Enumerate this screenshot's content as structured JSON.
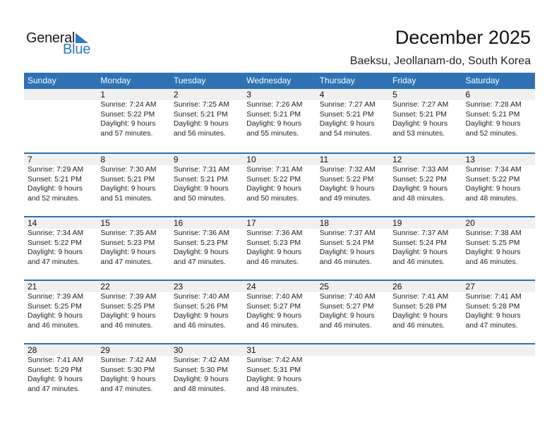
{
  "logo": {
    "word1": "General",
    "word2": "Blue",
    "icon": "triangle-flag-icon",
    "brand_color": "#2e78c0"
  },
  "header": {
    "title": "December 2025",
    "location": "Baeksu, Jeollanam-do, South Korea"
  },
  "colors": {
    "header_bg": "#2e72b4",
    "date_band_bg": "#f0f0f0",
    "row_border": "#2e72b4"
  },
  "weekdays": [
    "Sunday",
    "Monday",
    "Tuesday",
    "Wednesday",
    "Thursday",
    "Friday",
    "Saturday"
  ],
  "weeks": [
    [
      null,
      {
        "day": "1",
        "sunrise": "Sunrise: 7:24 AM",
        "sunset": "Sunset: 5:22 PM",
        "daylight1": "Daylight: 9 hours",
        "daylight2": "and 57 minutes."
      },
      {
        "day": "2",
        "sunrise": "Sunrise: 7:25 AM",
        "sunset": "Sunset: 5:21 PM",
        "daylight1": "Daylight: 9 hours",
        "daylight2": "and 56 minutes."
      },
      {
        "day": "3",
        "sunrise": "Sunrise: 7:26 AM",
        "sunset": "Sunset: 5:21 PM",
        "daylight1": "Daylight: 9 hours",
        "daylight2": "and 55 minutes."
      },
      {
        "day": "4",
        "sunrise": "Sunrise: 7:27 AM",
        "sunset": "Sunset: 5:21 PM",
        "daylight1": "Daylight: 9 hours",
        "daylight2": "and 54 minutes."
      },
      {
        "day": "5",
        "sunrise": "Sunrise: 7:27 AM",
        "sunset": "Sunset: 5:21 PM",
        "daylight1": "Daylight: 9 hours",
        "daylight2": "and 53 minutes."
      },
      {
        "day": "6",
        "sunrise": "Sunrise: 7:28 AM",
        "sunset": "Sunset: 5:21 PM",
        "daylight1": "Daylight: 9 hours",
        "daylight2": "and 52 minutes."
      }
    ],
    [
      {
        "day": "7",
        "sunrise": "Sunrise: 7:29 AM",
        "sunset": "Sunset: 5:21 PM",
        "daylight1": "Daylight: 9 hours",
        "daylight2": "and 52 minutes."
      },
      {
        "day": "8",
        "sunrise": "Sunrise: 7:30 AM",
        "sunset": "Sunset: 5:21 PM",
        "daylight1": "Daylight: 9 hours",
        "daylight2": "and 51 minutes."
      },
      {
        "day": "9",
        "sunrise": "Sunrise: 7:31 AM",
        "sunset": "Sunset: 5:21 PM",
        "daylight1": "Daylight: 9 hours",
        "daylight2": "and 50 minutes."
      },
      {
        "day": "10",
        "sunrise": "Sunrise: 7:31 AM",
        "sunset": "Sunset: 5:22 PM",
        "daylight1": "Daylight: 9 hours",
        "daylight2": "and 50 minutes."
      },
      {
        "day": "11",
        "sunrise": "Sunrise: 7:32 AM",
        "sunset": "Sunset: 5:22 PM",
        "daylight1": "Daylight: 9 hours",
        "daylight2": "and 49 minutes."
      },
      {
        "day": "12",
        "sunrise": "Sunrise: 7:33 AM",
        "sunset": "Sunset: 5:22 PM",
        "daylight1": "Daylight: 9 hours",
        "daylight2": "and 48 minutes."
      },
      {
        "day": "13",
        "sunrise": "Sunrise: 7:34 AM",
        "sunset": "Sunset: 5:22 PM",
        "daylight1": "Daylight: 9 hours",
        "daylight2": "and 48 minutes."
      }
    ],
    [
      {
        "day": "14",
        "sunrise": "Sunrise: 7:34 AM",
        "sunset": "Sunset: 5:22 PM",
        "daylight1": "Daylight: 9 hours",
        "daylight2": "and 47 minutes."
      },
      {
        "day": "15",
        "sunrise": "Sunrise: 7:35 AM",
        "sunset": "Sunset: 5:23 PM",
        "daylight1": "Daylight: 9 hours",
        "daylight2": "and 47 minutes."
      },
      {
        "day": "16",
        "sunrise": "Sunrise: 7:36 AM",
        "sunset": "Sunset: 5:23 PM",
        "daylight1": "Daylight: 9 hours",
        "daylight2": "and 47 minutes."
      },
      {
        "day": "17",
        "sunrise": "Sunrise: 7:36 AM",
        "sunset": "Sunset: 5:23 PM",
        "daylight1": "Daylight: 9 hours",
        "daylight2": "and 46 minutes."
      },
      {
        "day": "18",
        "sunrise": "Sunrise: 7:37 AM",
        "sunset": "Sunset: 5:24 PM",
        "daylight1": "Daylight: 9 hours",
        "daylight2": "and 46 minutes."
      },
      {
        "day": "19",
        "sunrise": "Sunrise: 7:37 AM",
        "sunset": "Sunset: 5:24 PM",
        "daylight1": "Daylight: 9 hours",
        "daylight2": "and 46 minutes."
      },
      {
        "day": "20",
        "sunrise": "Sunrise: 7:38 AM",
        "sunset": "Sunset: 5:25 PM",
        "daylight1": "Daylight: 9 hours",
        "daylight2": "and 46 minutes."
      }
    ],
    [
      {
        "day": "21",
        "sunrise": "Sunrise: 7:39 AM",
        "sunset": "Sunset: 5:25 PM",
        "daylight1": "Daylight: 9 hours",
        "daylight2": "and 46 minutes."
      },
      {
        "day": "22",
        "sunrise": "Sunrise: 7:39 AM",
        "sunset": "Sunset: 5:25 PM",
        "daylight1": "Daylight: 9 hours",
        "daylight2": "and 46 minutes."
      },
      {
        "day": "23",
        "sunrise": "Sunrise: 7:40 AM",
        "sunset": "Sunset: 5:26 PM",
        "daylight1": "Daylight: 9 hours",
        "daylight2": "and 46 minutes."
      },
      {
        "day": "24",
        "sunrise": "Sunrise: 7:40 AM",
        "sunset": "Sunset: 5:27 PM",
        "daylight1": "Daylight: 9 hours",
        "daylight2": "and 46 minutes."
      },
      {
        "day": "25",
        "sunrise": "Sunrise: 7:40 AM",
        "sunset": "Sunset: 5:27 PM",
        "daylight1": "Daylight: 9 hours",
        "daylight2": "and 46 minutes."
      },
      {
        "day": "26",
        "sunrise": "Sunrise: 7:41 AM",
        "sunset": "Sunset: 5:28 PM",
        "daylight1": "Daylight: 9 hours",
        "daylight2": "and 46 minutes."
      },
      {
        "day": "27",
        "sunrise": "Sunrise: 7:41 AM",
        "sunset": "Sunset: 5:28 PM",
        "daylight1": "Daylight: 9 hours",
        "daylight2": "and 47 minutes."
      }
    ],
    [
      {
        "day": "28",
        "sunrise": "Sunrise: 7:41 AM",
        "sunset": "Sunset: 5:29 PM",
        "daylight1": "Daylight: 9 hours",
        "daylight2": "and 47 minutes."
      },
      {
        "day": "29",
        "sunrise": "Sunrise: 7:42 AM",
        "sunset": "Sunset: 5:30 PM",
        "daylight1": "Daylight: 9 hours",
        "daylight2": "and 47 minutes."
      },
      {
        "day": "30",
        "sunrise": "Sunrise: 7:42 AM",
        "sunset": "Sunset: 5:30 PM",
        "daylight1": "Daylight: 9 hours",
        "daylight2": "and 48 minutes."
      },
      {
        "day": "31",
        "sunrise": "Sunrise: 7:42 AM",
        "sunset": "Sunset: 5:31 PM",
        "daylight1": "Daylight: 9 hours",
        "daylight2": "and 48 minutes."
      },
      null,
      null,
      null
    ]
  ]
}
